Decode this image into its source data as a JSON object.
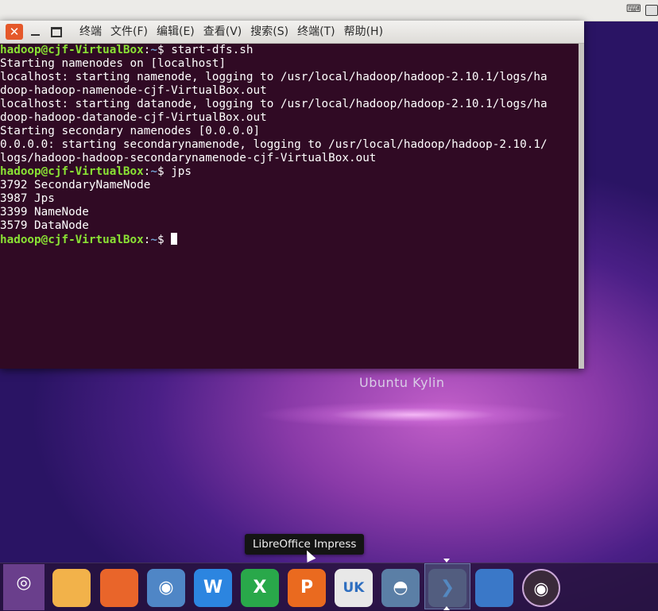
{
  "menubar": {
    "items": [
      "终端",
      "文件(F)",
      "编辑(E)",
      "查看(V)",
      "搜索(S)",
      "终端(T)",
      "帮助(H)"
    ]
  },
  "window_controls": {
    "close": "✕"
  },
  "terminal": {
    "lines": [
      {
        "user": "hadoop@cjf-VirtualBox",
        "sep": ":",
        "path": "~",
        "cmd": "$ start-dfs.sh"
      },
      {
        "text": "Starting namenodes on [localhost]"
      },
      {
        "text": "localhost: starting namenode, logging to /usr/local/hadoop/hadoop-2.10.1/logs/ha"
      },
      {
        "text": "doop-hadoop-namenode-cjf-VirtualBox.out"
      },
      {
        "text": "localhost: starting datanode, logging to /usr/local/hadoop/hadoop-2.10.1/logs/ha"
      },
      {
        "text": "doop-hadoop-datanode-cjf-VirtualBox.out"
      },
      {
        "text": "Starting secondary namenodes [0.0.0.0]"
      },
      {
        "text": "0.0.0.0: starting secondarynamenode, logging to /usr/local/hadoop/hadoop-2.10.1/"
      },
      {
        "text": "logs/hadoop-hadoop-secondarynamenode-cjf-VirtualBox.out"
      },
      {
        "user": "hadoop@cjf-VirtualBox",
        "sep": ":",
        "path": "~",
        "cmd": "$ jps"
      },
      {
        "text": "3792 SecondaryNameNode"
      },
      {
        "text": "3987 Jps"
      },
      {
        "text": "3399 NameNode"
      },
      {
        "text": "3579 DataNode"
      },
      {
        "user": "hadoop@cjf-VirtualBox",
        "sep": ":",
        "path": "~",
        "cmd": "$ ",
        "cursor": true
      }
    ]
  },
  "desktop": {
    "brand": "Ubuntu Kylin"
  },
  "tooltip": {
    "text": "LibreOffice Impress"
  },
  "dock": {
    "items": [
      {
        "name": "dash-home-icon",
        "bg": "#6a3f8c",
        "glyph": "◎"
      },
      {
        "name": "files-folder-icon",
        "bg": "#f2b24a",
        "glyph": ""
      },
      {
        "name": "firefox-icon",
        "bg": "#e9652a",
        "glyph": ""
      },
      {
        "name": "browser-icon",
        "bg": "#4f86c6",
        "glyph": "◉"
      },
      {
        "name": "writer-icon",
        "bg": "#2c85e0",
        "glyph": "W"
      },
      {
        "name": "calc-icon",
        "bg": "#29a84a",
        "glyph": "X"
      },
      {
        "name": "impress-icon",
        "bg": "#ea6a1f",
        "glyph": "P"
      },
      {
        "name": "software-center-icon",
        "bg": "#e8e8e8",
        "glyph": "UK"
      },
      {
        "name": "kylin-assistant-icon",
        "bg": "#5b7fa6",
        "glyph": "◓"
      },
      {
        "name": "terminal-icon",
        "bg": "#4a5570",
        "glyph": "❯"
      },
      {
        "name": "workspace-switcher-icon",
        "bg": "#3a78c8",
        "glyph": ""
      },
      {
        "name": "dvd-icon",
        "bg": "#3a2a3a",
        "glyph": "◉"
      }
    ]
  }
}
